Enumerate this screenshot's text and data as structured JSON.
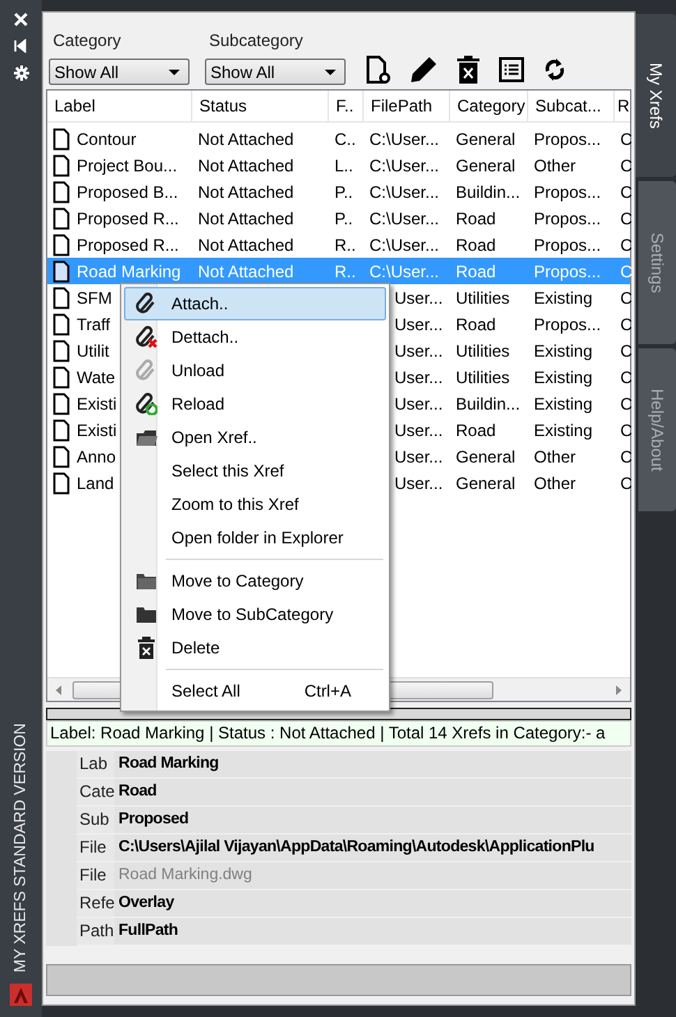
{
  "side_strip": {
    "title": "MY XREFS STANDARD VERSION"
  },
  "side_tabs": [
    {
      "label": "My Xrefs",
      "selected": true
    },
    {
      "label": "Settings",
      "selected": false
    },
    {
      "label": "Help/About",
      "selected": false
    }
  ],
  "filters": [
    {
      "label": "Category",
      "value": "Show All"
    },
    {
      "label": "Subcategory",
      "value": "Show All"
    }
  ],
  "table": {
    "columns": [
      "Label",
      "Status",
      "F..",
      "FilePath",
      "Category",
      "Subcat...",
      "R"
    ],
    "rows": [
      {
        "cells": [
          "Contour",
          "Not Attached",
          "C..",
          "C:\\User...",
          "General",
          "Propos...",
          "C"
        ],
        "selected": false
      },
      {
        "cells": [
          "Project Bou...",
          "Not Attached",
          "L..",
          "C:\\User...",
          "General",
          "Other",
          "C"
        ],
        "selected": false
      },
      {
        "cells": [
          "Proposed B...",
          "Not Attached",
          "P..",
          "C:\\User...",
          "Buildin...",
          "Propos...",
          "C"
        ],
        "selected": false
      },
      {
        "cells": [
          "Proposed R...",
          "Not Attached",
          "P..",
          "C:\\User...",
          "Road",
          "Propos...",
          "C"
        ],
        "selected": false
      },
      {
        "cells": [
          "Proposed R...",
          "Not Attached",
          "R..",
          "C:\\User...",
          "Road",
          "Propos...",
          "C"
        ],
        "selected": false
      },
      {
        "cells": [
          "Road Marking",
          "Not Attached",
          "R..",
          "C:\\User...",
          "Road",
          "Propos...",
          "C"
        ],
        "selected": true
      },
      {
        "cells": [
          "SFM",
          null,
          null,
          "User...",
          "Utilities",
          "Existing",
          "C"
        ],
        "selected": false
      },
      {
        "cells": [
          "Traff",
          null,
          null,
          "User...",
          "Road",
          "Propos...",
          "C"
        ],
        "selected": false
      },
      {
        "cells": [
          "Utilit",
          null,
          null,
          "User...",
          "Utilities",
          "Existing",
          "C"
        ],
        "selected": false
      },
      {
        "cells": [
          "Wate",
          null,
          null,
          "User...",
          "Utilities",
          "Existing",
          "C"
        ],
        "selected": false
      },
      {
        "cells": [
          "Existi",
          null,
          null,
          "User...",
          "Buildin...",
          "Existing",
          "C"
        ],
        "selected": false
      },
      {
        "cells": [
          "Existi",
          null,
          null,
          "User...",
          "Road",
          "Existing",
          "C"
        ],
        "selected": false
      },
      {
        "cells": [
          "Anno",
          null,
          null,
          "User...",
          "General",
          "Other",
          "C"
        ],
        "selected": false
      },
      {
        "cells": [
          "Land",
          null,
          null,
          "User...",
          "General",
          "Other",
          "C"
        ],
        "selected": false
      }
    ]
  },
  "context_menu": {
    "items": [
      {
        "kind": "clip",
        "label": "Attach..",
        "selected": true
      },
      {
        "kind": "unclip",
        "label": "Dettach..",
        "selected": false
      },
      {
        "kind": "greyclip",
        "label": "Unload",
        "selected": false
      },
      {
        "kind": "reclip",
        "label": "Reload",
        "selected": false
      },
      {
        "kind": "opener",
        "label": "Open Xref..",
        "selected": false
      },
      {
        "kind": "plain",
        "label": "Select this Xref",
        "selected": false
      },
      {
        "kind": "plain",
        "label": "Zoom to this Xref",
        "selected": false
      },
      {
        "kind": "plain",
        "label": "Open folder in Explorer",
        "selected": false
      },
      {
        "kind": "separator"
      },
      {
        "kind": "folder",
        "label": "Move to Category",
        "selected": false
      },
      {
        "kind": "darkfolder",
        "label": "Move to SubCategory",
        "selected": false
      },
      {
        "kind": "trash",
        "label": "Delete",
        "selected": false
      },
      {
        "kind": "separator"
      },
      {
        "kind": "plain",
        "label": "Select All",
        "shortcut": "Ctrl+A",
        "selected": false
      }
    ]
  },
  "progress_bar": {
    "level": 0
  },
  "status_line": "Label: Road Marking | Status : Not Attached | Total 14 Xrefs in Category:-  a",
  "properties": [
    {
      "key": "Lab",
      "value": "Road Marking",
      "disabled": false
    },
    {
      "key": "Cate",
      "value": "Road",
      "disabled": false
    },
    {
      "key": "Sub",
      "value": "Proposed",
      "disabled": false
    },
    {
      "key": "File",
      "value": "C:\\Users\\Ajilal Vijayan\\AppData\\Roaming\\Autodesk\\ApplicationPlu",
      "disabled": false
    },
    {
      "key": "File",
      "value": "Road Marking.dwg",
      "disabled": true
    },
    {
      "key": "Refe",
      "value": "Overlay",
      "disabled": false
    },
    {
      "key": "Path",
      "value": "FullPath",
      "disabled": false
    }
  ]
}
